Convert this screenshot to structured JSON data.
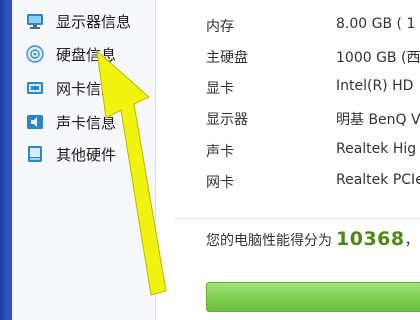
{
  "sidebar": {
    "items": [
      {
        "label": "显示器信息",
        "icon": "monitor-icon"
      },
      {
        "label": "硬盘信息",
        "icon": "disk-icon"
      },
      {
        "label": "网卡信息",
        "icon": "network-card-icon"
      },
      {
        "label": "声卡信息",
        "icon": "sound-card-icon"
      },
      {
        "label": "其他硬件",
        "icon": "other-hardware-icon"
      }
    ]
  },
  "specs": {
    "rows": [
      {
        "key": "内存",
        "value": "8.00 GB ( 1"
      },
      {
        "key": "主硬盘",
        "value": "1000 GB (西"
      },
      {
        "key": "显卡",
        "value": "Intel(R) HD"
      },
      {
        "key": "显示器",
        "value": "明基 BenQ V"
      },
      {
        "key": "声卡",
        "value": "Realtek Hig"
      },
      {
        "key": "网卡",
        "value": "Realtek PCIe"
      }
    ]
  },
  "score": {
    "label": "您的电脑性能得分为",
    "value": "10368",
    "suffix": "，"
  },
  "colors": {
    "accent_green": "#4a8a12",
    "arrow_yellow": "#f2f20f",
    "sidebar_strip": "#2d56c4"
  },
  "annotation": {
    "icon": "pointer-arrow-icon"
  }
}
